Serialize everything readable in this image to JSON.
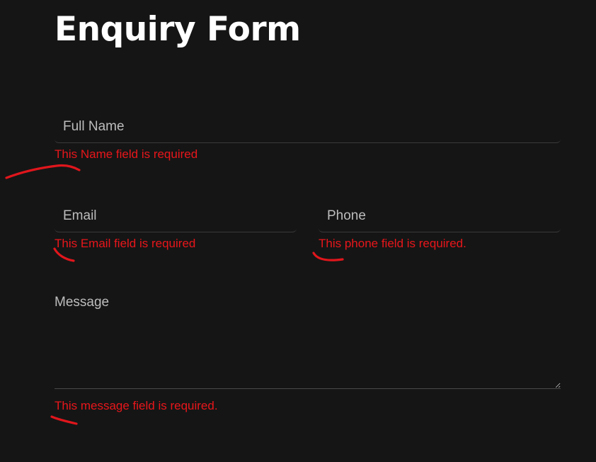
{
  "form": {
    "title": "Enquiry Form",
    "fields": {
      "name": {
        "placeholder": "Full Name",
        "value": "",
        "error": "This Name field is required"
      },
      "email": {
        "placeholder": "Email",
        "value": "",
        "error": "This Email field is required"
      },
      "phone": {
        "placeholder": "Phone",
        "value": "",
        "error": "This phone field is required."
      },
      "message": {
        "placeholder": "Message",
        "value": "",
        "error": "This message field is required."
      }
    }
  },
  "colors": {
    "background": "#151515",
    "title": "#ffffff",
    "error": "#e8161b",
    "annotation": "#e0161c"
  }
}
